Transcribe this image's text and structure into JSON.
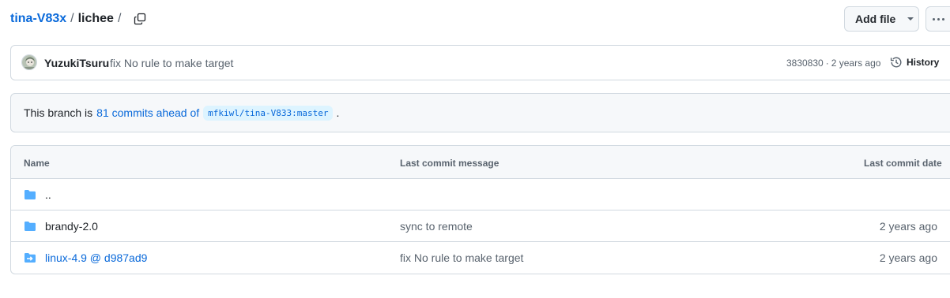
{
  "breadcrumb": {
    "repo": "tina-V83x",
    "separator": "/",
    "directory": "lichee",
    "trailing_separator": "/"
  },
  "actions": {
    "add_file_label": "Add file"
  },
  "latest_commit": {
    "author": "YuzukiTsuru",
    "message": "fix No rule to make target",
    "sha": "3830830",
    "separator": "·",
    "age": "2 years ago",
    "history_label": "History"
  },
  "branch_info": {
    "prefix": "This branch is",
    "commits_link": "81 commits ahead of",
    "ref": "mfkiwl/tina-V833:master",
    "suffix": "."
  },
  "table": {
    "headers": {
      "name": "Name",
      "message": "Last commit message",
      "date": "Last commit date"
    },
    "rows": [
      {
        "icon": "folder-icon",
        "name": "..",
        "message": "",
        "date": ""
      },
      {
        "icon": "folder-icon",
        "name": "brandy-2.0",
        "message": "sync to remote",
        "date": "2 years ago"
      },
      {
        "icon": "submodule-icon",
        "name": "linux-4.9 @ d987ad9",
        "message": "fix No rule to make target",
        "date": "2 years ago"
      }
    ]
  },
  "colors": {
    "link": "#0969da",
    "folder": "#54aeff",
    "muted": "#59636e",
    "border": "#d1d9e0",
    "subtle_bg": "#f6f8fa"
  }
}
